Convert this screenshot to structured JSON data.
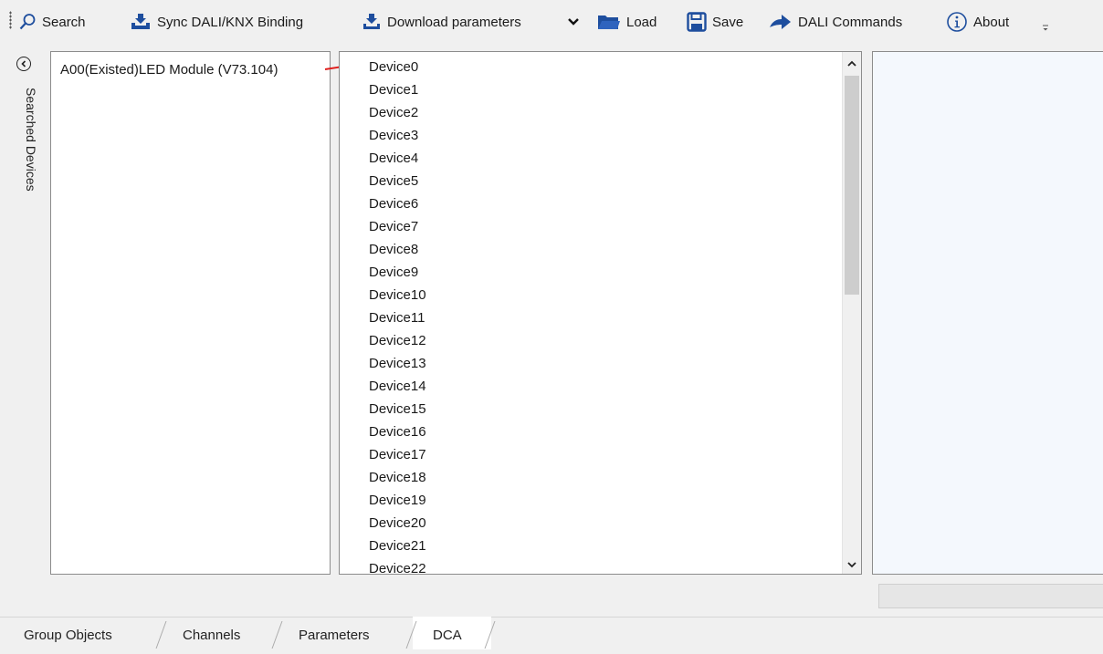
{
  "toolbar": {
    "search": "Search",
    "sync": "Sync DALI/KNX Binding",
    "download": "Download parameters",
    "load": "Load",
    "save": "Save",
    "dali_commands": "DALI Commands",
    "about": "About"
  },
  "sidebar": {
    "label": "Searched Devices"
  },
  "left_panel": {
    "item": "A00(Existed)LED Module (V73.104)"
  },
  "device_list": [
    "Device0",
    "Device1",
    "Device2",
    "Device3",
    "Device4",
    "Device5",
    "Device6",
    "Device7",
    "Device8",
    "Device9",
    "Device10",
    "Device11",
    "Device12",
    "Device13",
    "Device14",
    "Device15",
    "Device16",
    "Device17",
    "Device18",
    "Device19",
    "Device20",
    "Device21",
    "Device22"
  ],
  "tabs": [
    "Group Objects",
    "Channels",
    "Parameters",
    "DCA"
  ],
  "active_tab": "DCA",
  "colors": {
    "icon_blue": "#1e4e9e",
    "arrow_red": "#e0201e",
    "right_panel_bg": "#f4f8fd"
  }
}
